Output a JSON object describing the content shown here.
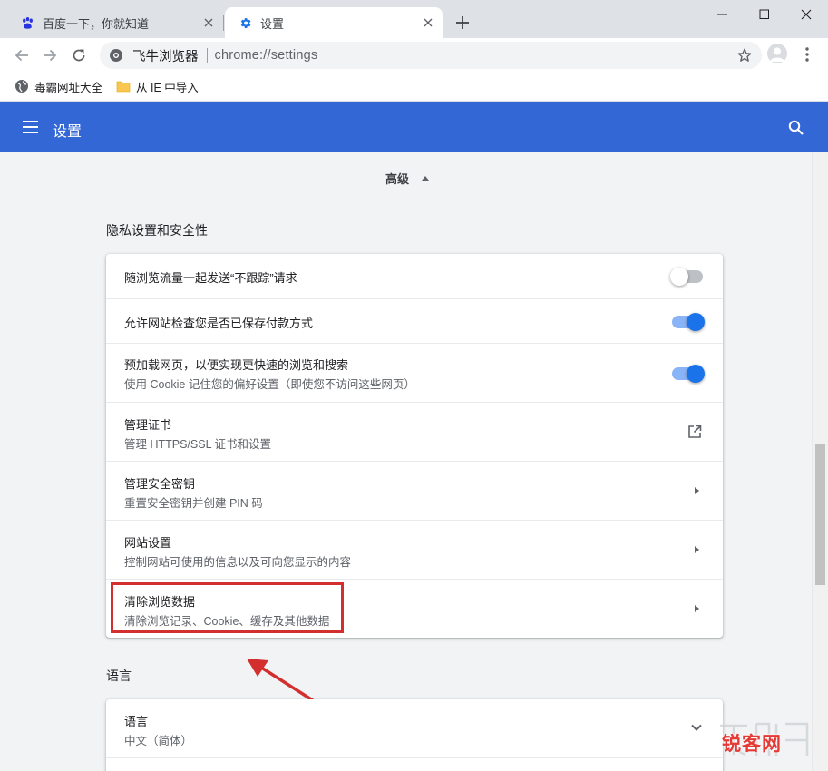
{
  "tabs": [
    {
      "title": "百度一下，你就知道",
      "icon": "baidu-paw-icon",
      "active": false
    },
    {
      "title": "设置",
      "icon": "settings-gear-icon",
      "active": true
    }
  ],
  "omnibox": {
    "site_name": "飞牛浏览器",
    "url": "chrome://settings"
  },
  "bookmarks": [
    {
      "label": "毒霸网址大全",
      "icon": "globe-icon"
    },
    {
      "label": "从 IE 中导入",
      "icon": "folder-icon"
    }
  ],
  "header": {
    "title": "设置"
  },
  "advanced": {
    "label": "高级"
  },
  "privacy": {
    "title": "隐私设置和安全性",
    "rows": [
      {
        "label": "随浏览流量一起发送“不跟踪”请求",
        "sub": "",
        "control": "toggle",
        "state": "off"
      },
      {
        "label": "允许网站检查您是否已保存付款方式",
        "sub": "",
        "control": "toggle",
        "state": "on"
      },
      {
        "label": "预加载网页，以便实现更快速的浏览和搜索",
        "sub": "使用 Cookie 记住您的偏好设置（即使您不访问这些网页）",
        "control": "toggle",
        "state": "on"
      },
      {
        "label": "管理证书",
        "sub": "管理 HTTPS/SSL 证书和设置",
        "control": "external-link"
      },
      {
        "label": "管理安全密钥",
        "sub": "重置安全密钥并创建 PIN 码",
        "control": "chevron"
      },
      {
        "label": "网站设置",
        "sub": "控制网站可使用的信息以及可向您显示的内容",
        "control": "chevron"
      },
      {
        "label": "清除浏览数据",
        "sub": "清除浏览记录、Cookie、缓存及其他数据",
        "control": "chevron"
      }
    ]
  },
  "languages": {
    "title": "语言",
    "rows": [
      {
        "label": "语言",
        "sub": "中文（简体）",
        "control": "chevron-down"
      }
    ]
  },
  "watermark": {
    "text": "锐客网"
  },
  "colors": {
    "header_blue": "#3367d6",
    "toggle_on": "#1a73e8",
    "highlight_red": "#d32f2f"
  }
}
